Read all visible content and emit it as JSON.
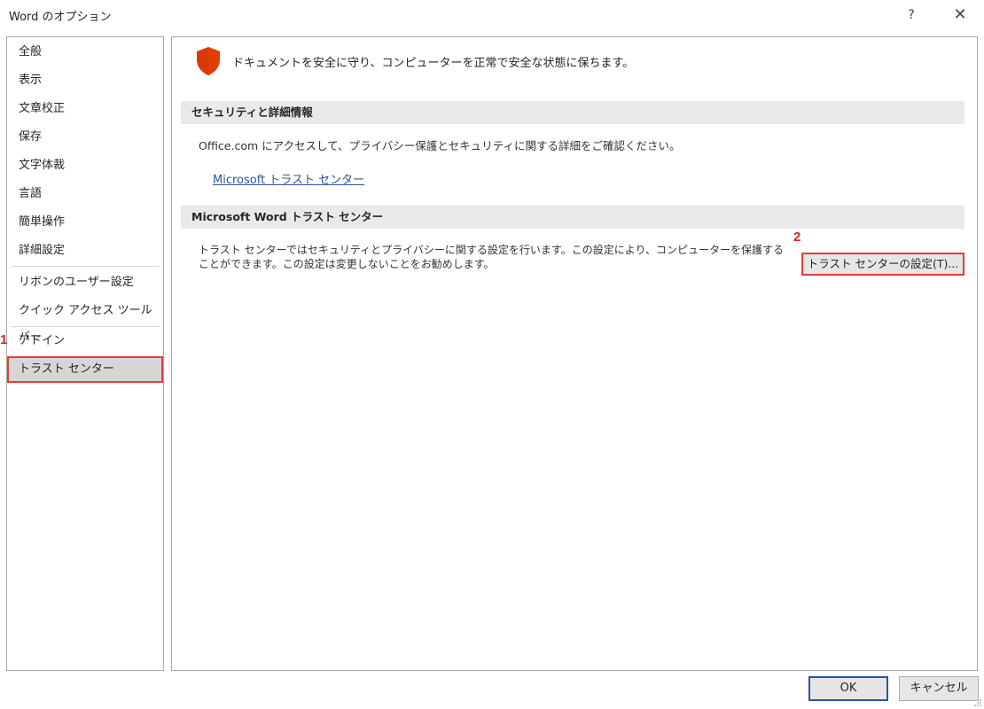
{
  "window": {
    "title": "Word のオプション",
    "help_label": "?",
    "close_label": "✕"
  },
  "nav": {
    "items": [
      {
        "label": "全般"
      },
      {
        "label": "表示"
      },
      {
        "label": "文章校正"
      },
      {
        "label": "保存"
      },
      {
        "label": "文字体裁"
      },
      {
        "label": "言語"
      },
      {
        "label": "簡単操作"
      },
      {
        "label": "詳細設定"
      },
      {
        "label": "リボンのユーザー設定"
      },
      {
        "label": "クイック アクセス ツール バー"
      },
      {
        "label": "アドイン"
      },
      {
        "label": "トラスト センター",
        "selected": true
      }
    ]
  },
  "annotations": {
    "marker1": "1",
    "marker2": "2",
    "color": "#e43c3c"
  },
  "content": {
    "intro": "ドキュメントを安全に守り、コンピューターを正常で安全な状態に保ちます。",
    "security_header": "セキュリティと詳細情報",
    "security_text": "Office.com にアクセスして、プライバシー保護とセキュリティに関する詳細をご確認ください。",
    "security_link": "Microsoft トラスト センター",
    "trust_header": "Microsoft Word トラスト センター",
    "trust_text": "トラスト センターではセキュリティとプライバシーに関する設定を行います。この設定により、コンピューターを保護することができます。この設定は変更しないことをお勧めします。",
    "trust_button": "トラスト センターの設定(T)...",
    "shield_icon": "shield-icon",
    "shield_color": "#d83b01"
  },
  "footer": {
    "ok_label": "OK",
    "cancel_label": "キャンセル"
  }
}
